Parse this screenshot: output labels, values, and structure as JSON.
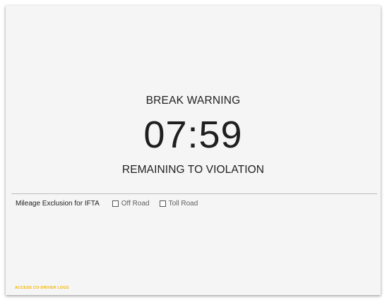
{
  "break_warning": {
    "title": "BREAK WARNING",
    "countdown": "07:59",
    "subtitle": "REMAINING TO VIOLATION"
  },
  "mileage_exclusion": {
    "label": "Mileage Exclusion for IFTA",
    "options": [
      {
        "label": "Off Road",
        "checked": false
      },
      {
        "label": "Toll Road",
        "checked": false
      }
    ]
  },
  "footer": {
    "access_link": "ACCESS CO-DRIVER LOGS"
  },
  "colors": {
    "background": "#f5f5f5",
    "text": "#212121",
    "link_accent": "#f5b800",
    "divider": "#bdbdbd"
  }
}
